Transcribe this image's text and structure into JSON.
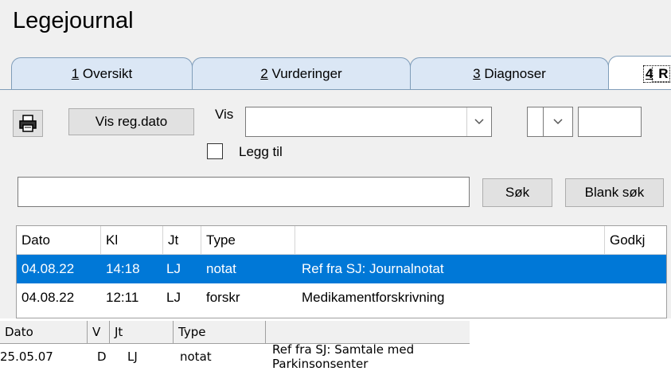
{
  "app": {
    "title": "Legejournal"
  },
  "tabs": [
    {
      "num": "1",
      "label": " Oversikt"
    },
    {
      "num": "2",
      "label": " Vurderinger"
    },
    {
      "num": "3",
      "label": " Diagnoser"
    },
    {
      "num": "4",
      "label": " R"
    }
  ],
  "toolbar": {
    "print_icon": "printer-icon",
    "vis_reg_label": "Vis reg.dato",
    "vis_label": "Vis",
    "vis_value": "",
    "legg_til_label": "Legg til",
    "small_field_value": ""
  },
  "search": {
    "value": "",
    "sok_label": "Søk",
    "blank_label": "Blank søk"
  },
  "journal_table": {
    "columns": [
      "Dato",
      "Kl",
      "Jt",
      "Type",
      "",
      "Godkj"
    ],
    "rows": [
      {
        "dato": "04.08.22",
        "kl": "14:18",
        "jt": "LJ",
        "type": "notat",
        "desc": "Ref fra SJ: Journalnotat",
        "godkj": "",
        "selected": true
      },
      {
        "dato": "04.08.22",
        "kl": "12:11",
        "jt": "LJ",
        "type": "forskr",
        "desc": "Medikamentforskrivning",
        "godkj": "",
        "selected": false
      }
    ]
  },
  "bottom_table": {
    "columns": [
      "Dato",
      "V",
      "Jt",
      "Type",
      ""
    ],
    "rows": [
      {
        "dato": "25.05.07",
        "v": "D",
        "jt": "LJ",
        "type": "notat",
        "desc": "Ref fra SJ: Samtale med Parkinsonsenter"
      }
    ]
  },
  "colors": {
    "selection": "#0078d7",
    "tab": "#dbe7f5",
    "panel": "#f0f0f0"
  }
}
